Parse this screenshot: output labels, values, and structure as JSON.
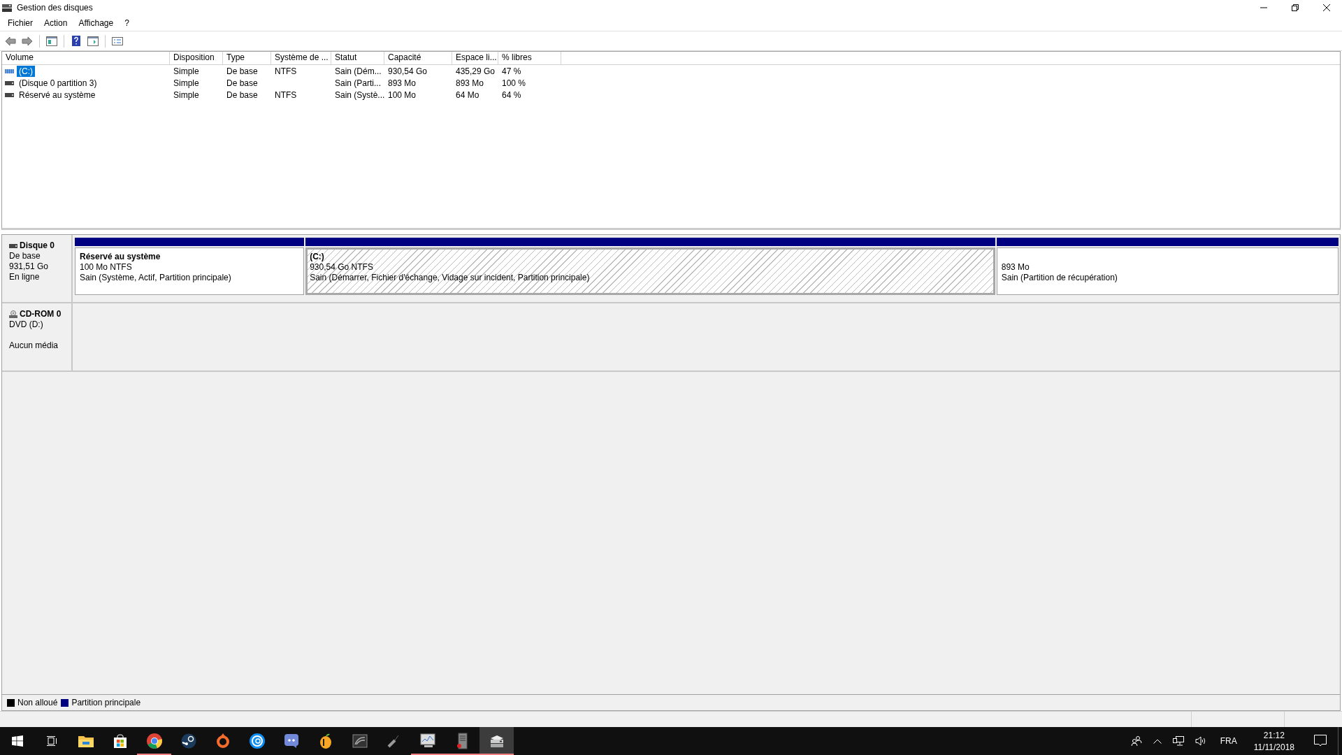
{
  "window": {
    "title": "Gestion des disques"
  },
  "menu": [
    "Fichier",
    "Action",
    "Affichage",
    "?"
  ],
  "table": {
    "columns": [
      "Volume",
      "Disposition",
      "Type",
      "Système de ...",
      "Statut",
      "Capacité",
      "Espace li...",
      "% libres"
    ],
    "rows": [
      {
        "kind": "striped",
        "selected": true,
        "cells": [
          "(C:)",
          "Simple",
          "De base",
          "NTFS",
          "Sain (Dém...",
          "930,54 Go",
          "435,29 Go",
          "47 %"
        ]
      },
      {
        "kind": "plain",
        "selected": false,
        "cells": [
          "(Disque 0 partition 3)",
          "Simple",
          "De base",
          "",
          "Sain (Parti...",
          "893 Mo",
          "893 Mo",
          "100 %"
        ]
      },
      {
        "kind": "plain",
        "selected": false,
        "cells": [
          "Réservé au système",
          "Simple",
          "De base",
          "NTFS",
          "Sain (Systè...",
          "100 Mo",
          "64 Mo",
          "64 %"
        ]
      }
    ]
  },
  "disks": [
    {
      "kind": "disk",
      "name": "Disque 0",
      "type": "De base",
      "size": "931,51 Go",
      "status": "En ligne",
      "partitions": [
        {
          "title": "Réservé au système",
          "size": "100 Mo NTFS",
          "status": "Sain (Système, Actif, Partition principale)",
          "selected": false
        },
        {
          "title": "(C:)",
          "size": "930,54 Go NTFS",
          "status": "Sain (Démarrer, Fichier d'échange, Vidage sur incident, Partition principale)",
          "selected": true
        },
        {
          "size": "893 Mo",
          "status": "Sain (Partition de récupération)",
          "selected": false
        }
      ]
    },
    {
      "kind": "cdrom",
      "name": "CD-ROM 0",
      "type": "DVD (D:)",
      "status": "Aucun média"
    }
  ],
  "legend": [
    {
      "label": "Non alloué",
      "color": "#000000"
    },
    {
      "label": "Partition principale",
      "color": "#000080"
    }
  ],
  "taskbar": {
    "apps": [
      {
        "kind": "explorer",
        "running": false,
        "selected": false
      },
      {
        "kind": "store",
        "running": false,
        "selected": false
      },
      {
        "kind": "chrome",
        "running": true,
        "selected": false
      },
      {
        "kind": "steam",
        "running": false,
        "selected": false
      },
      {
        "kind": "origin",
        "running": false,
        "selected": false
      },
      {
        "kind": "uplay",
        "running": false,
        "selected": false
      },
      {
        "kind": "discord",
        "running": false,
        "selected": false
      },
      {
        "kind": "fruit",
        "running": false,
        "selected": false
      },
      {
        "kind": "nvidia",
        "running": false,
        "selected": false
      },
      {
        "kind": "usb",
        "running": false,
        "selected": false
      },
      {
        "kind": "monitor",
        "running": true,
        "selected": false
      },
      {
        "kind": "server",
        "running": true,
        "selected": false
      },
      {
        "kind": "diskmgmt",
        "running": true,
        "selected": true
      }
    ],
    "language": "FRA",
    "time": "21:12",
    "date": "11/11/2018"
  }
}
